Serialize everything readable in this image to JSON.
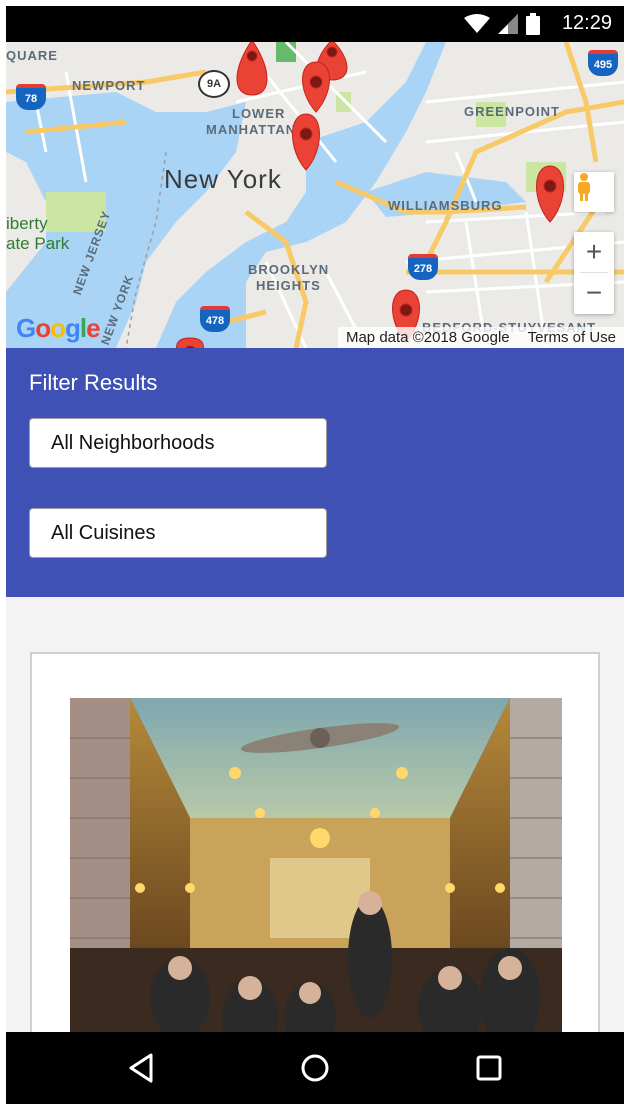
{
  "status_bar": {
    "time": "12:29",
    "icons": [
      "wifi-icon",
      "signal-icon",
      "battery-icon"
    ]
  },
  "map": {
    "city_label": "New York",
    "neighborhood_labels": {
      "square": "QUARE",
      "newport": "NEWPORT",
      "lower_manhattan_1": "LOWER",
      "lower_manhattan_2": "MANHATTAN",
      "greenpoint": "GREENPOINT",
      "williamsburg": "WILLIAMSBURG",
      "brooklyn_heights_1": "BROOKLYN",
      "brooklyn_heights_2": "HEIGHTS",
      "bedford": "BEDFORD-STUYVESANT",
      "new_jersey": "NEW JERSEY",
      "new_york_vertical": "NEW YORK"
    },
    "park_label_1": "iberty",
    "park_label_2": "ate Park",
    "highway_shields": [
      "495",
      "78",
      "278",
      "478"
    ],
    "route_marker": "9A",
    "map_data_credit": "Map data ©2018 Google",
    "terms_link": "Terms of Use",
    "logo_text": "Google",
    "zoom_in_label": "+",
    "zoom_out_label": "−",
    "colors": {
      "water": "#a9d4f5",
      "land": "#eceae6",
      "road_major": "#f8c967",
      "road_minor": "#ffffff",
      "park": "#cbe6a3",
      "marker": "#ea4335"
    }
  },
  "filter": {
    "title": "Filter Results",
    "neighborhood_select": "All Neighborhoods",
    "cuisine_select": "All Cuisines",
    "color": "#3f51b5"
  },
  "nav_bar": {
    "buttons": [
      "back-icon",
      "home-icon",
      "recents-icon"
    ]
  }
}
